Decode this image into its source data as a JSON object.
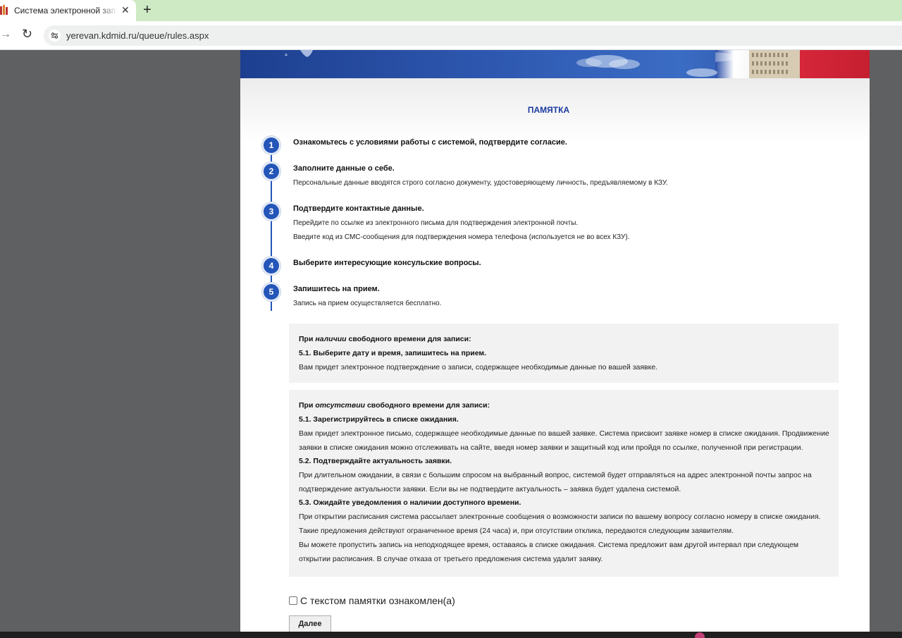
{
  "browser": {
    "tab_title": "Система электронной записи",
    "tab_close": "✕",
    "new_tab": "+",
    "url": "yerevan.kdmid.ru/queue/rules.aspx",
    "forward": "→",
    "reload": "↻"
  },
  "page": {
    "heading": "ПАМЯТКА",
    "steps": [
      {
        "num": "1",
        "title": "Ознакомьтесь с условиями работы с системой, подтвердите согласие.",
        "lines": []
      },
      {
        "num": "2",
        "title": "Заполните данные о себе.",
        "lines": [
          "Персональные данные вводятся строго согласно документу, удостоверяющему личность, предъявляемому в КЗУ."
        ]
      },
      {
        "num": "3",
        "title": "Подтвердите контактные данные.",
        "lines": [
          "Перейдите по ссылке из электронного письма для подтверждения электронной почты.",
          "Введите код из СМС-сообщения для подтверждения номера телефона (используется не во всех КЗУ)."
        ]
      },
      {
        "num": "4",
        "title": "Выберите интересующие консульские вопросы.",
        "lines": []
      },
      {
        "num": "5",
        "title": "Запишитесь на прием.",
        "lines": [
          "Запись на прием осуществляется бесплатно."
        ]
      }
    ],
    "box1": {
      "head_pre": "При ",
      "head_em": "наличии",
      "head_post": " свободного времени для записи:",
      "sub": "5.1. Выберите дату и время, запишитесь на прием.",
      "text": "Вам придет электронное подтверждение о записи, содержащее необходимые данные по вашей заявке."
    },
    "box2": {
      "head_pre": "При ",
      "head_em": "отсутствии",
      "head_post": " свободного времени для записи:",
      "s1": "5.1. Зарегистрируйтесь в списке ожидания.",
      "s1_t1": "Вам придет электронное письмо, содержащее необходимые данные по вашей заявке. Система присвоит заявке номер в списке ожидания. Продвижение",
      "s1_t2": "заявки в списке ожидания можно отслеживать на сайте, введя номер заявки и защитный код или пройдя по ссылке, полученной при регистрации.",
      "s2": "5.2. Подтверждайте актуальность заявки.",
      "s2_t1": "При длительном ожидании, в связи с большим спросом на выбранный вопрос, системой будет отправляться на адрес электронной почты запрос на",
      "s2_t2": "подтверждение актуальности заявки. Если вы не подтвердите актуальность – заявка будет удалена системой.",
      "s3": "5.3. Ожидайте уведомления о наличии доступного времени.",
      "s3_t1": "При открытии расписания система рассылает электронные сообщения о возможности записи по вашему вопросу согласно номеру в списке ожидания.",
      "s3_t2": "Такие предложения действуют ограниченное время (24 часа) и, при отсутствии отклика, передаются следующим заявителям.",
      "s3_t3": "Вы можете пропустить запись на неподходящее время, оставаясь в списке ожидания. Система предложит вам другой интервал при следующем",
      "s3_t4": "открытии расписания. В случае отказа от третьего предложения система удалит заявку."
    },
    "agree_label": "С текстом памятки ознакомлен(а)",
    "agree_checked": false,
    "next_label": "Далее"
  }
}
